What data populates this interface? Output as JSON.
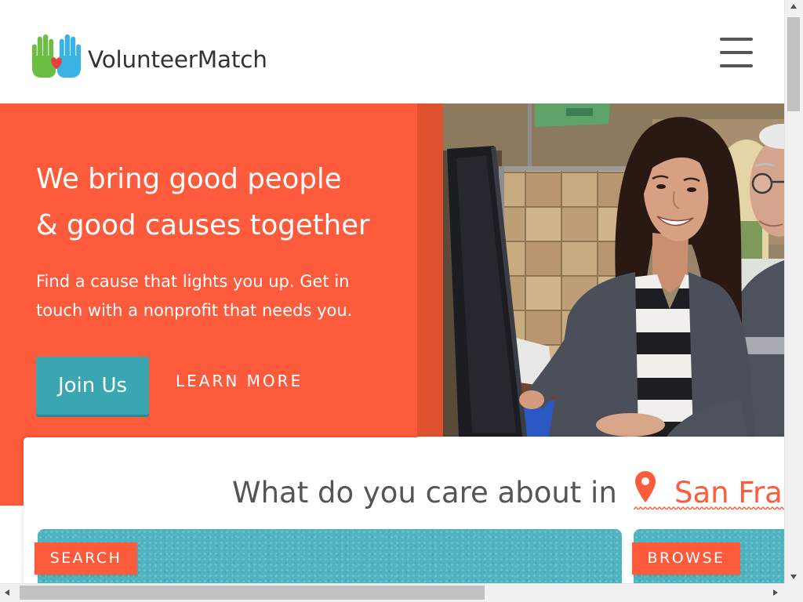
{
  "header": {
    "brand_name": "VolunteerMatch",
    "logo_icon": "hands-heart-logo-icon",
    "menu_icon": "hamburger-menu-icon"
  },
  "hero": {
    "headline_lines": [
      "We bring good people",
      "& good causes together"
    ],
    "subtext_lines": [
      "Find a cause that lights you up. Get in",
      "touch with a nonprofit that needs you."
    ],
    "join_button_label": "Join Us",
    "learn_more_label": "LEARN MORE"
  },
  "finder": {
    "question": "What do you care about in",
    "location_value": "San Fra",
    "location_icon": "map-pin-icon",
    "tabs": [
      {
        "label": "SEARCH"
      },
      {
        "label": "BROWSE"
      }
    ]
  },
  "scrollbars": {
    "arrow_icons": [
      "scroll-up-arrow-icon",
      "scroll-down-arrow-icon",
      "scroll-left-arrow-icon",
      "scroll-right-arrow-icon"
    ]
  },
  "colors": {
    "brand_orange": "#FD5B3C",
    "teal": "#3AA6B2",
    "panel_teal": "#4FB4C0",
    "heading_gray": "#555555",
    "brand_green": "#6CBE45",
    "brand_blue": "#39B3E3",
    "heart_red": "#E8413C"
  }
}
